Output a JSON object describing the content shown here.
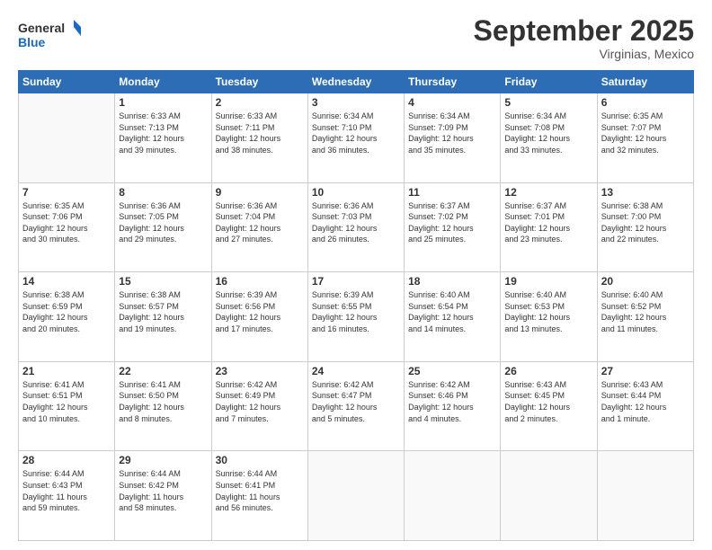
{
  "header": {
    "logo": {
      "line1": "General",
      "line2": "Blue"
    },
    "title": "September 2025",
    "subtitle": "Virginias, Mexico"
  },
  "days_of_week": [
    "Sunday",
    "Monday",
    "Tuesday",
    "Wednesday",
    "Thursday",
    "Friday",
    "Saturday"
  ],
  "weeks": [
    [
      {
        "day": "",
        "content": ""
      },
      {
        "day": "1",
        "content": "Sunrise: 6:33 AM\nSunset: 7:13 PM\nDaylight: 12 hours\nand 39 minutes."
      },
      {
        "day": "2",
        "content": "Sunrise: 6:33 AM\nSunset: 7:11 PM\nDaylight: 12 hours\nand 38 minutes."
      },
      {
        "day": "3",
        "content": "Sunrise: 6:34 AM\nSunset: 7:10 PM\nDaylight: 12 hours\nand 36 minutes."
      },
      {
        "day": "4",
        "content": "Sunrise: 6:34 AM\nSunset: 7:09 PM\nDaylight: 12 hours\nand 35 minutes."
      },
      {
        "day": "5",
        "content": "Sunrise: 6:34 AM\nSunset: 7:08 PM\nDaylight: 12 hours\nand 33 minutes."
      },
      {
        "day": "6",
        "content": "Sunrise: 6:35 AM\nSunset: 7:07 PM\nDaylight: 12 hours\nand 32 minutes."
      }
    ],
    [
      {
        "day": "7",
        "content": "Sunrise: 6:35 AM\nSunset: 7:06 PM\nDaylight: 12 hours\nand 30 minutes."
      },
      {
        "day": "8",
        "content": "Sunrise: 6:36 AM\nSunset: 7:05 PM\nDaylight: 12 hours\nand 29 minutes."
      },
      {
        "day": "9",
        "content": "Sunrise: 6:36 AM\nSunset: 7:04 PM\nDaylight: 12 hours\nand 27 minutes."
      },
      {
        "day": "10",
        "content": "Sunrise: 6:36 AM\nSunset: 7:03 PM\nDaylight: 12 hours\nand 26 minutes."
      },
      {
        "day": "11",
        "content": "Sunrise: 6:37 AM\nSunset: 7:02 PM\nDaylight: 12 hours\nand 25 minutes."
      },
      {
        "day": "12",
        "content": "Sunrise: 6:37 AM\nSunset: 7:01 PM\nDaylight: 12 hours\nand 23 minutes."
      },
      {
        "day": "13",
        "content": "Sunrise: 6:38 AM\nSunset: 7:00 PM\nDaylight: 12 hours\nand 22 minutes."
      }
    ],
    [
      {
        "day": "14",
        "content": "Sunrise: 6:38 AM\nSunset: 6:59 PM\nDaylight: 12 hours\nand 20 minutes."
      },
      {
        "day": "15",
        "content": "Sunrise: 6:38 AM\nSunset: 6:57 PM\nDaylight: 12 hours\nand 19 minutes."
      },
      {
        "day": "16",
        "content": "Sunrise: 6:39 AM\nSunset: 6:56 PM\nDaylight: 12 hours\nand 17 minutes."
      },
      {
        "day": "17",
        "content": "Sunrise: 6:39 AM\nSunset: 6:55 PM\nDaylight: 12 hours\nand 16 minutes."
      },
      {
        "day": "18",
        "content": "Sunrise: 6:40 AM\nSunset: 6:54 PM\nDaylight: 12 hours\nand 14 minutes."
      },
      {
        "day": "19",
        "content": "Sunrise: 6:40 AM\nSunset: 6:53 PM\nDaylight: 12 hours\nand 13 minutes."
      },
      {
        "day": "20",
        "content": "Sunrise: 6:40 AM\nSunset: 6:52 PM\nDaylight: 12 hours\nand 11 minutes."
      }
    ],
    [
      {
        "day": "21",
        "content": "Sunrise: 6:41 AM\nSunset: 6:51 PM\nDaylight: 12 hours\nand 10 minutes."
      },
      {
        "day": "22",
        "content": "Sunrise: 6:41 AM\nSunset: 6:50 PM\nDaylight: 12 hours\nand 8 minutes."
      },
      {
        "day": "23",
        "content": "Sunrise: 6:42 AM\nSunset: 6:49 PM\nDaylight: 12 hours\nand 7 minutes."
      },
      {
        "day": "24",
        "content": "Sunrise: 6:42 AM\nSunset: 6:47 PM\nDaylight: 12 hours\nand 5 minutes."
      },
      {
        "day": "25",
        "content": "Sunrise: 6:42 AM\nSunset: 6:46 PM\nDaylight: 12 hours\nand 4 minutes."
      },
      {
        "day": "26",
        "content": "Sunrise: 6:43 AM\nSunset: 6:45 PM\nDaylight: 12 hours\nand 2 minutes."
      },
      {
        "day": "27",
        "content": "Sunrise: 6:43 AM\nSunset: 6:44 PM\nDaylight: 12 hours\nand 1 minute."
      }
    ],
    [
      {
        "day": "28",
        "content": "Sunrise: 6:44 AM\nSunset: 6:43 PM\nDaylight: 11 hours\nand 59 minutes."
      },
      {
        "day": "29",
        "content": "Sunrise: 6:44 AM\nSunset: 6:42 PM\nDaylight: 11 hours\nand 58 minutes."
      },
      {
        "day": "30",
        "content": "Sunrise: 6:44 AM\nSunset: 6:41 PM\nDaylight: 11 hours\nand 56 minutes."
      },
      {
        "day": "",
        "content": ""
      },
      {
        "day": "",
        "content": ""
      },
      {
        "day": "",
        "content": ""
      },
      {
        "day": "",
        "content": ""
      }
    ]
  ]
}
